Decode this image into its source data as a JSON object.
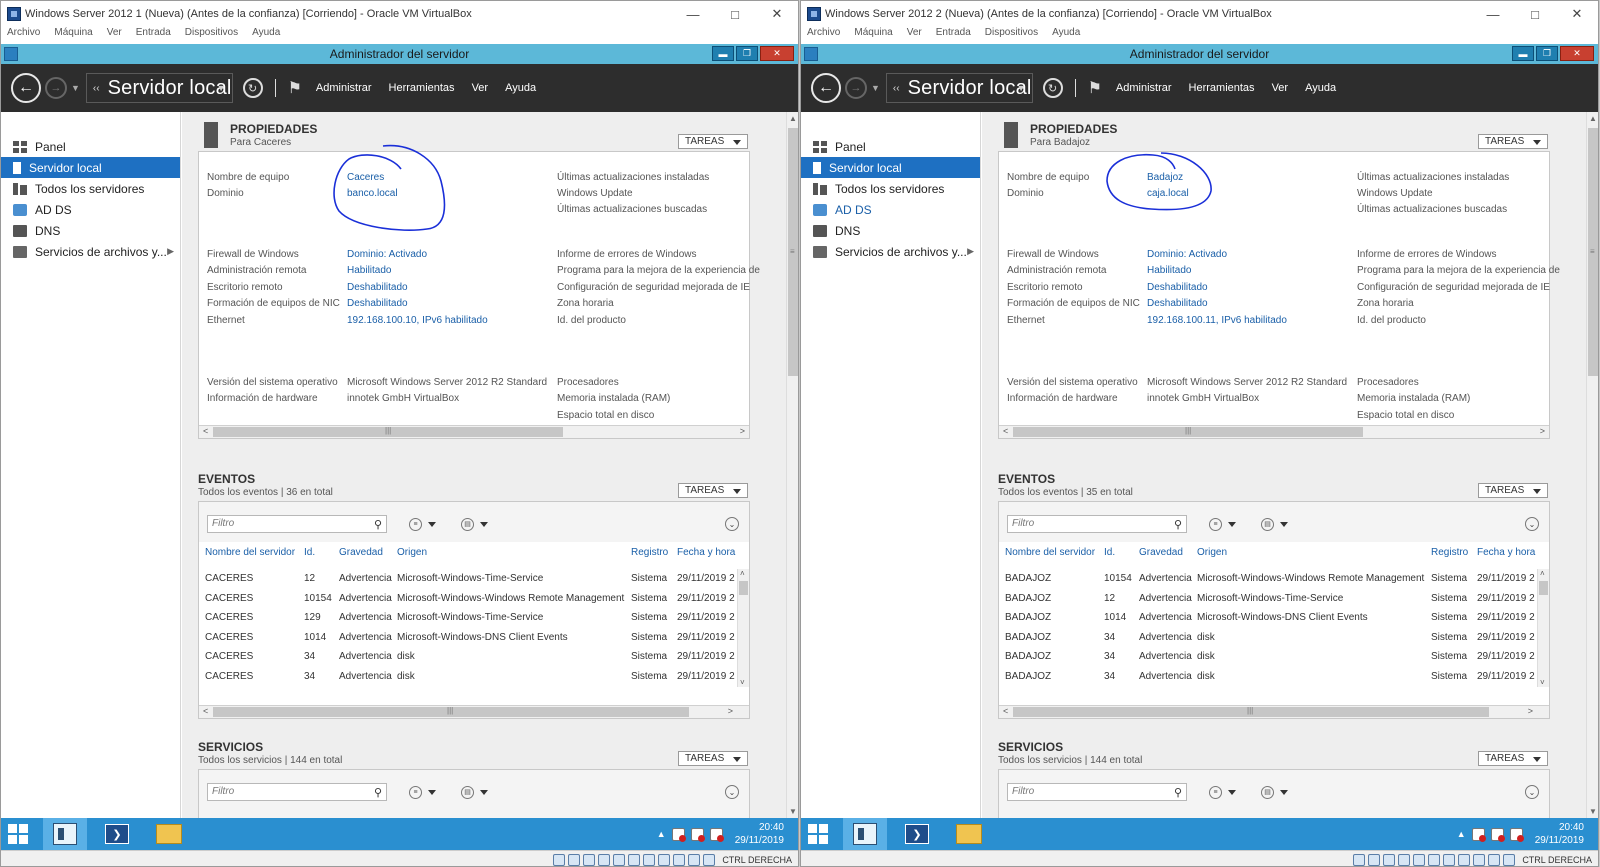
{
  "menu": {
    "archivo": "Archivo",
    "maquina": "Máquina",
    "ver": "Ver",
    "entrada": "Entrada",
    "dispositivos": "Dispositivos",
    "ayuda": "Ayuda"
  },
  "srv_title": "Administrador del servidor",
  "breadcrumb": "Servidor local",
  "header_menu": {
    "administrar": "Administrar",
    "herramientas": "Herramientas",
    "ver": "Ver",
    "ayuda": "Ayuda"
  },
  "sidebar": {
    "panel": "Panel",
    "servidor_local": "Servidor local",
    "todos": "Todos los servidores",
    "adds": "AD DS",
    "dns": "DNS",
    "archivos": "Servicios de archivos y..."
  },
  "sections": {
    "propiedades": "PROPIEDADES",
    "eventos": "EVENTOS",
    "servicios": "SERVICIOS",
    "tareas": "TAREAS",
    "filtro": "Filtro",
    "servicios_sub": "Todos los servicios | 144 en total"
  },
  "labels": {
    "nombre_equipo": "Nombre de equipo",
    "dominio": "Dominio",
    "ult_act": "Últimas actualizaciones instaladas",
    "win_update": "Windows Update",
    "ult_busc": "Últimas actualizaciones buscadas",
    "firewall": "Firewall de Windows",
    "admin_remota": "Administración remota",
    "escritorio": "Escritorio remoto",
    "formacion": "Formación de equipos de NIC",
    "ethernet": "Ethernet",
    "firewall_v": "Dominio: Activado",
    "admin_remota_v": "Habilitado",
    "escritorio_v": "Deshabilitado",
    "formacion_v": "Deshabilitado",
    "informe": "Informe de errores de Windows",
    "programa": "Programa para la mejora de la experiencia de",
    "config": "Configuración de seguridad mejorada de IE",
    "zona": "Zona horaria",
    "idprod": "Id. del producto",
    "version": "Versión del sistema operativo",
    "hardware": "Información de hardware",
    "version_v": "Microsoft Windows Server 2012 R2 Standard",
    "hardware_v": "innotek GmbH VirtualBox",
    "procesadores": "Procesadores",
    "memoria": "Memoria instalada (RAM)",
    "espacio": "Espacio total en disco"
  },
  "ev_cols": {
    "servidor": "Nombre del servidor",
    "id": "Id.",
    "gravedad": "Gravedad",
    "origen": "Origen",
    "registro": "Registro",
    "fecha": "Fecha y hora"
  },
  "taskbar": {
    "time": "20:40",
    "date": "29/11/2019"
  },
  "hostkey": "CTRL DERECHA",
  "annotation_color": "#1a2fd8",
  "vm1": {
    "title": "Windows Server 2012 1 (Nueva) (Antes de la confianza) [Corriendo] - Oracle VM VirtualBox",
    "para": "Para Caceres",
    "nombre": "Caceres",
    "dominio": "banco.local",
    "ethernet": "192.168.100.10, IPv6 habilitado",
    "eventos_sub": "Todos los eventos | 36 en total",
    "events": [
      {
        "srv": "CACERES",
        "id": "12",
        "grav": "Advertencia",
        "origen": "Microsoft-Windows-Time-Service",
        "reg": "Sistema",
        "fecha": "29/11/2019 2"
      },
      {
        "srv": "CACERES",
        "id": "10154",
        "grav": "Advertencia",
        "origen": "Microsoft-Windows-Windows Remote Management",
        "reg": "Sistema",
        "fecha": "29/11/2019 2"
      },
      {
        "srv": "CACERES",
        "id": "129",
        "grav": "Advertencia",
        "origen": "Microsoft-Windows-Time-Service",
        "reg": "Sistema",
        "fecha": "29/11/2019 2"
      },
      {
        "srv": "CACERES",
        "id": "1014",
        "grav": "Advertencia",
        "origen": "Microsoft-Windows-DNS Client Events",
        "reg": "Sistema",
        "fecha": "29/11/2019 2"
      },
      {
        "srv": "CACERES",
        "id": "34",
        "grav": "Advertencia",
        "origen": "disk",
        "reg": "Sistema",
        "fecha": "29/11/2019 2"
      },
      {
        "srv": "CACERES",
        "id": "34",
        "grav": "Advertencia",
        "origen": "disk",
        "reg": "Sistema",
        "fecha": "29/11/2019 2"
      }
    ]
  },
  "vm2": {
    "title": "Windows Server 2012 2 (Nueva) (Antes de la confianza) [Corriendo] - Oracle VM VirtualBox",
    "para": "Para Badajoz",
    "nombre": "Badajoz",
    "dominio": "caja.local",
    "ethernet": "192.168.100.11, IPv6 habilitado",
    "eventos_sub": "Todos los eventos | 35 en total",
    "events": [
      {
        "srv": "BADAJOZ",
        "id": "10154",
        "grav": "Advertencia",
        "origen": "Microsoft-Windows-Windows Remote Management",
        "reg": "Sistema",
        "fecha": "29/11/2019 2"
      },
      {
        "srv": "BADAJOZ",
        "id": "12",
        "grav": "Advertencia",
        "origen": "Microsoft-Windows-Time-Service",
        "reg": "Sistema",
        "fecha": "29/11/2019 2"
      },
      {
        "srv": "BADAJOZ",
        "id": "1014",
        "grav": "Advertencia",
        "origen": "Microsoft-Windows-DNS Client Events",
        "reg": "Sistema",
        "fecha": "29/11/2019 2"
      },
      {
        "srv": "BADAJOZ",
        "id": "34",
        "grav": "Advertencia",
        "origen": "disk",
        "reg": "Sistema",
        "fecha": "29/11/2019 2"
      },
      {
        "srv": "BADAJOZ",
        "id": "34",
        "grav": "Advertencia",
        "origen": "disk",
        "reg": "Sistema",
        "fecha": "29/11/2019 2"
      },
      {
        "srv": "BADAJOZ",
        "id": "34",
        "grav": "Advertencia",
        "origen": "disk",
        "reg": "Sistema",
        "fecha": "29/11/2019 2"
      }
    ]
  }
}
